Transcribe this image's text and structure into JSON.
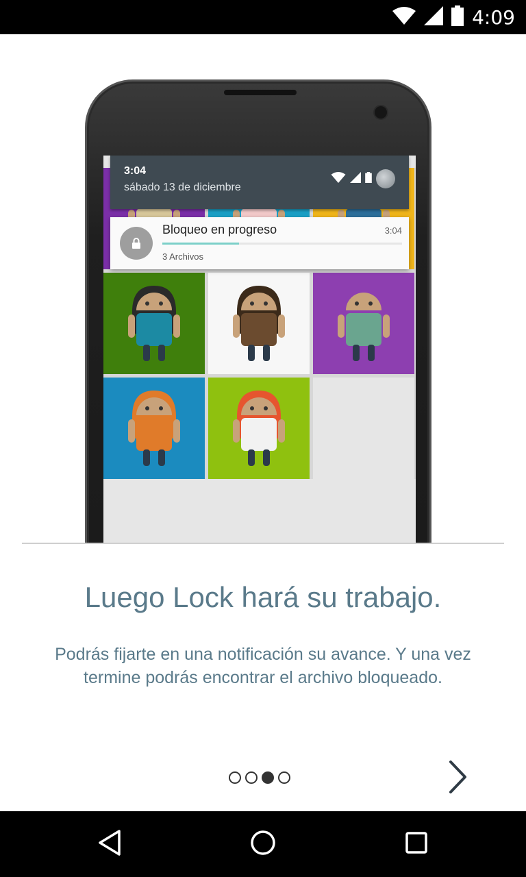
{
  "status_bar": {
    "time": "4:09",
    "icons": [
      "wifi-icon",
      "signal-icon",
      "battery-icon"
    ]
  },
  "illustration": {
    "notification_shade": {
      "time": "3:04",
      "date": "sábado 13 de diciembre"
    },
    "notification": {
      "title": "Bloqueo en progreso",
      "time": "3:04",
      "subtitle": "3 Archivos",
      "progress": 0.32
    },
    "tiles": [
      {
        "bg": "#7b2fa8",
        "kind": "dress-girl"
      },
      {
        "bg": "#1aa0c6",
        "kind": "pink-dress"
      },
      {
        "bg": "#f0b51a",
        "kind": "blue-shirt"
      },
      {
        "bg": "#3f7f0c",
        "kind": "girl-jacket"
      },
      {
        "bg": "#f7f7f7",
        "kind": "goggles"
      },
      {
        "bg": "#8d3fb0",
        "kind": "sweater"
      },
      {
        "bg": "#1b8bbf",
        "kind": "orange-hoodie"
      },
      {
        "bg": "#8fc10f",
        "kind": "red-hair"
      },
      {
        "bg": "#e6e6e6",
        "kind": "empty"
      }
    ]
  },
  "content": {
    "headline": "Luego Lock hará su trabajo.",
    "body": "Podrás fijarte en una notificación su avance. Y una vez termine podrás encontrar el archivo bloqueado."
  },
  "pager": {
    "total": 4,
    "active_index": 2
  },
  "next_button": {
    "icon": "chevron-right-icon"
  },
  "nav_bar": {
    "buttons": [
      "back-icon",
      "home-icon",
      "recents-icon"
    ]
  },
  "colors": {
    "text_accent": "#5a7a8a",
    "progress": "#7ccfc8"
  }
}
